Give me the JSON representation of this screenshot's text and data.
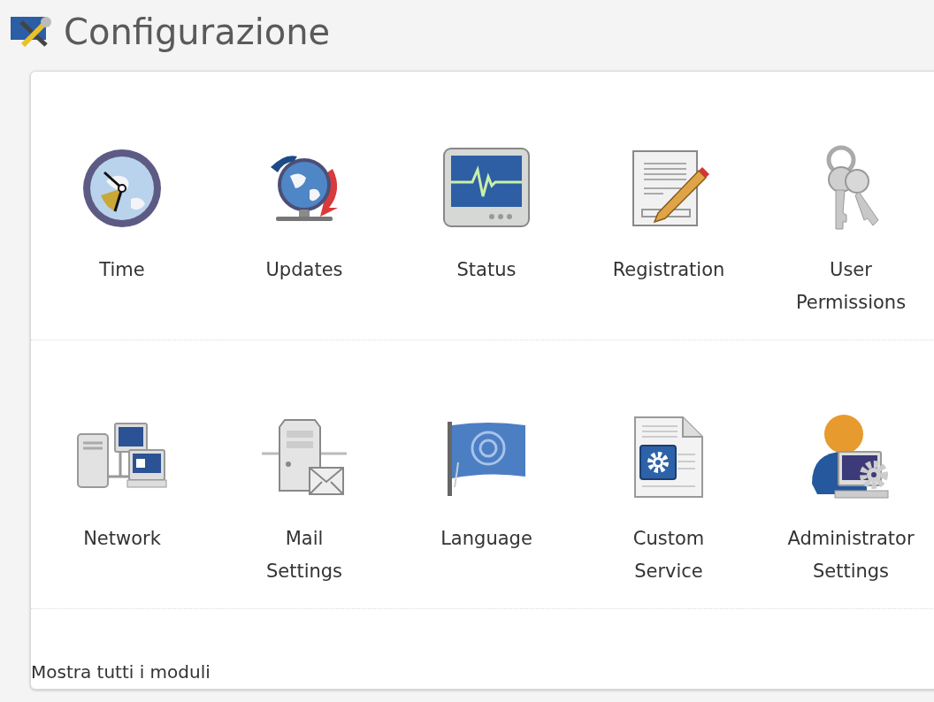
{
  "page": {
    "title": "Configurazione"
  },
  "rows": [
    [
      {
        "label": "Time"
      },
      {
        "label": "Updates"
      },
      {
        "label": "Status"
      },
      {
        "label": "Registration"
      },
      {
        "label": "User\nPermissions"
      }
    ],
    [
      {
        "label": "Network"
      },
      {
        "label": "Mail\nSettings"
      },
      {
        "label": "Language"
      },
      {
        "label": "Custom\nService"
      },
      {
        "label": "Administrator\nSettings"
      }
    ]
  ],
  "footer_link": "Mostra tutti i moduli"
}
